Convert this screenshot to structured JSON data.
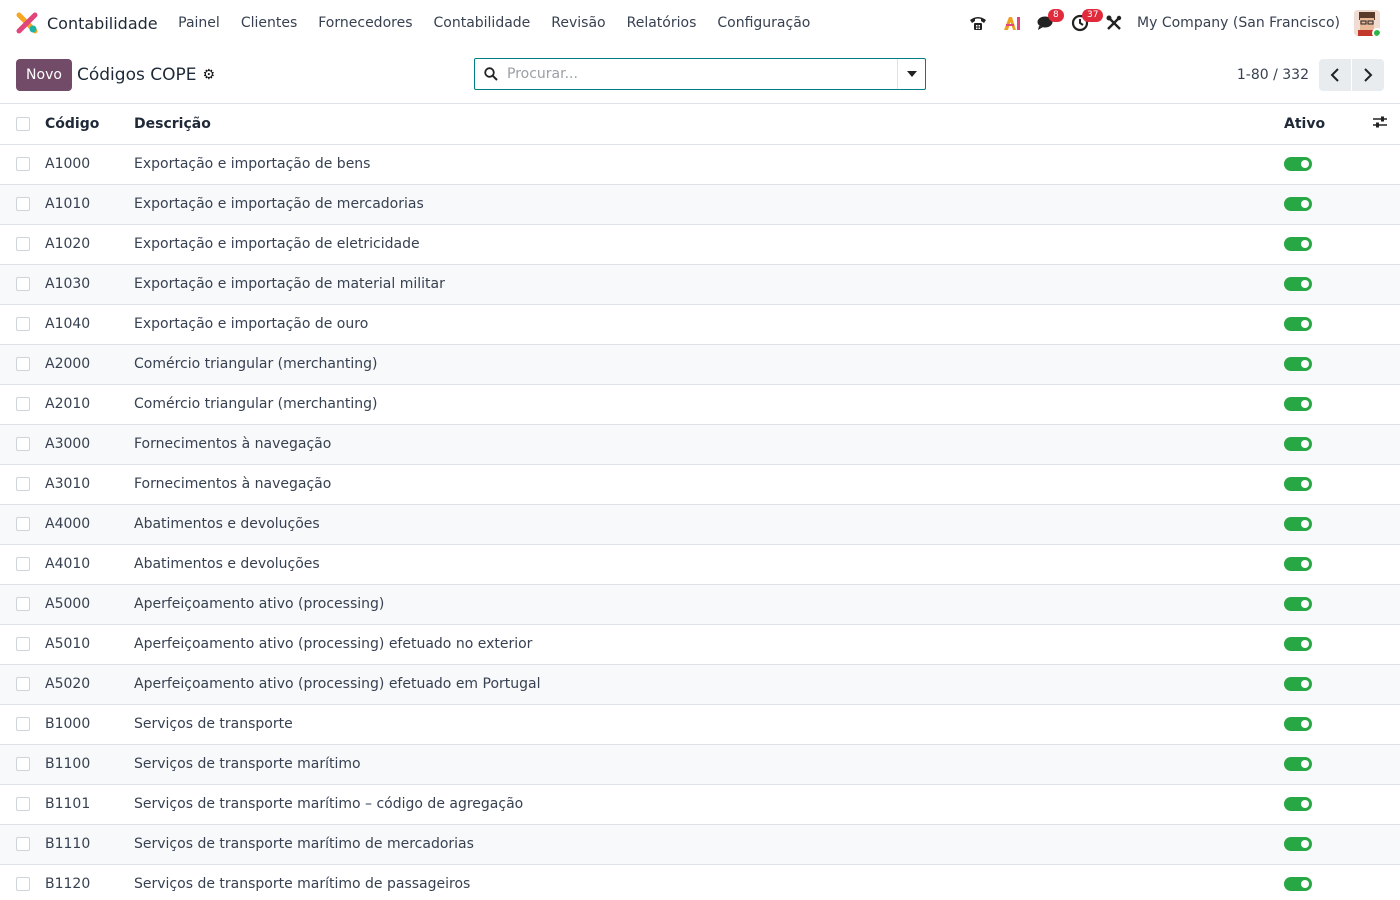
{
  "nav": {
    "app_name": "Contabilidade",
    "menu": [
      "Painel",
      "Clientes",
      "Fornecedores",
      "Contabilidade",
      "Revisão",
      "Relatórios",
      "Configuração"
    ],
    "messages_badge": "8",
    "activities_badge": "37",
    "company": "My Company (San Francisco)"
  },
  "control": {
    "new_label": "Novo",
    "title": "Códigos COPE",
    "search_placeholder": "Procurar...",
    "pager_value": "1-80 / 332"
  },
  "table": {
    "headers": {
      "code": "Código",
      "description": "Descrição",
      "active": "Ativo"
    },
    "rows": [
      {
        "code": "A1000",
        "description": "Exportação e importação de bens",
        "active": true
      },
      {
        "code": "A1010",
        "description": "Exportação e importação de mercadorias",
        "active": true
      },
      {
        "code": "A1020",
        "description": "Exportação e importação de eletricidade",
        "active": true
      },
      {
        "code": "A1030",
        "description": "Exportação e importação de material militar",
        "active": true
      },
      {
        "code": "A1040",
        "description": "Exportação e importação de ouro",
        "active": true
      },
      {
        "code": "A2000",
        "description": "Comércio triangular (merchanting)",
        "active": true
      },
      {
        "code": "A2010",
        "description": "Comércio triangular (merchanting)",
        "active": true
      },
      {
        "code": "A3000",
        "description": "Fornecimentos à navegação",
        "active": true
      },
      {
        "code": "A3010",
        "description": "Fornecimentos à navegação",
        "active": true
      },
      {
        "code": "A4000",
        "description": "Abatimentos e devoluções",
        "active": true
      },
      {
        "code": "A4010",
        "description": "Abatimentos e devoluções",
        "active": true
      },
      {
        "code": "A5000",
        "description": "Aperfeiçoamento ativo (processing)",
        "active": true
      },
      {
        "code": "A5010",
        "description": "Aperfeiçoamento ativo (processing) efetuado no exterior",
        "active": true
      },
      {
        "code": "A5020",
        "description": "Aperfeiçoamento ativo (processing) efetuado em Portugal",
        "active": true
      },
      {
        "code": "B1000",
        "description": "Serviços de transporte",
        "active": true
      },
      {
        "code": "B1100",
        "description": "Serviços de transporte marítimo",
        "active": true
      },
      {
        "code": "B1101",
        "description": "Serviços de transporte marítimo – código de agregação",
        "active": true
      },
      {
        "code": "B1110",
        "description": "Serviços de transporte marítimo de mercadorias",
        "active": true
      },
      {
        "code": "B1120",
        "description": "Serviços de transporte marítimo de passageiros",
        "active": true
      }
    ]
  },
  "colors": {
    "primary": "#714b67",
    "toggle_on": "#28a745",
    "badge": "#e02b3c",
    "search_border": "#017e84"
  },
  "icons": [
    "app-logo-icon",
    "phone-icon",
    "ai-icon",
    "chat-icon",
    "clock-icon",
    "tools-icon",
    "gear-icon",
    "search-icon",
    "caret-down-icon",
    "chevron-left-icon",
    "chevron-right-icon",
    "column-options-icon"
  ]
}
